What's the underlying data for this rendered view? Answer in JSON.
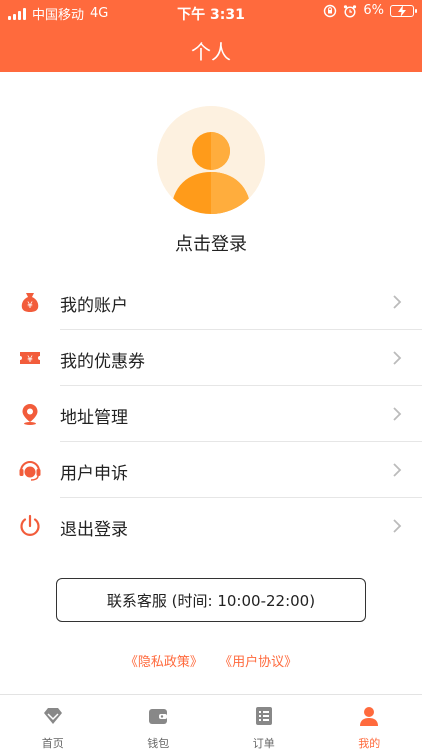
{
  "status_bar": {
    "carrier": "中国移动",
    "network": "4G",
    "time": "下午 3:31",
    "battery": "6%"
  },
  "header": {
    "title": "个人"
  },
  "profile": {
    "login_label": "点击登录"
  },
  "menu": {
    "items": [
      {
        "label": "我的账户",
        "icon": "money-bag-icon"
      },
      {
        "label": "我的优惠券",
        "icon": "coupon-icon"
      },
      {
        "label": "地址管理",
        "icon": "location-pin-icon"
      },
      {
        "label": "用户申诉",
        "icon": "customer-service-icon"
      },
      {
        "label": "退出登录",
        "icon": "power-icon"
      }
    ]
  },
  "contact_button": {
    "label": "联系客服 (时间: 10:00-22:00)"
  },
  "links": {
    "privacy": "《隐私政策》",
    "agreement": "《用户协议》"
  },
  "tabbar": {
    "tabs": [
      {
        "label": "首页",
        "icon": "diamond-icon"
      },
      {
        "label": "钱包",
        "icon": "wallet-icon"
      },
      {
        "label": "订单",
        "icon": "order-list-icon"
      },
      {
        "label": "我的",
        "icon": "user-icon"
      }
    ]
  },
  "colors": {
    "accent": "#ff6a3d",
    "avatar_bg": "#fdf1e0",
    "avatar_fg": "#ff9b1a"
  }
}
